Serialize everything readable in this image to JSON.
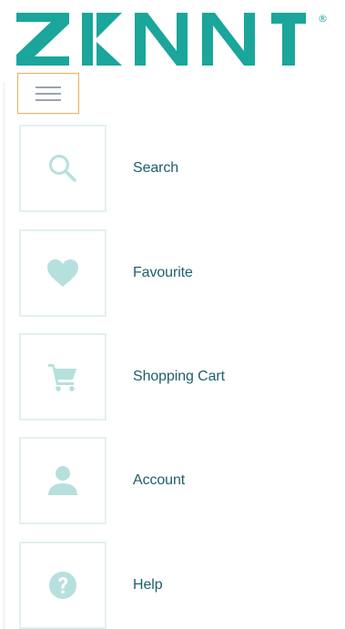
{
  "brand": {
    "logo_text": "ZENNI",
    "registered_mark": "®",
    "color": "#1aa69a"
  },
  "menu_button": {
    "icon": "hamburger-icon"
  },
  "nav": {
    "items": [
      {
        "label": "Search",
        "icon": "search-icon"
      },
      {
        "label": "Favourite",
        "icon": "heart-icon"
      },
      {
        "label": "Shopping Cart",
        "icon": "shopping-cart-icon"
      },
      {
        "label": "Account",
        "icon": "user-icon"
      },
      {
        "label": "Help",
        "icon": "help-icon"
      }
    ]
  },
  "colors": {
    "icon_tint": "#b6e0dd",
    "label_text": "#1d5e6c",
    "box_border": "#e3f0f0",
    "menu_border": "#e6b15d"
  }
}
